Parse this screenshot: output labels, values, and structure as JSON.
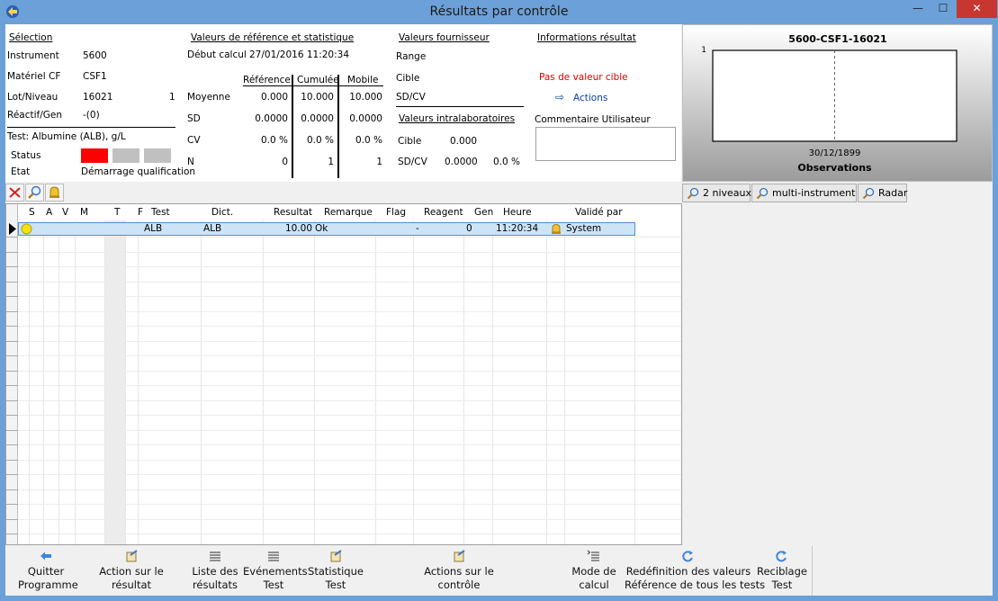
{
  "window": {
    "title": "Résultats par contrôle",
    "minimize": "—",
    "maximize": "☐",
    "close": "✕"
  },
  "selection": {
    "header": "Sélection",
    "instrument_label": "Instrument",
    "instrument_value": "5600",
    "materiel_label": "Matériel CF",
    "materiel_value": "CSF1",
    "lot_label": "Lot/Niveau",
    "lot_value": "16021",
    "niveau_value": "1",
    "reactif_label": "Réactif/Gen",
    "reactif_value": "-(0)",
    "test_label": "Test: Albumine (ALB), g/L",
    "status_label": "Status",
    "etat_label": "Etat",
    "etat_value": "Démarrage qualification",
    "status_colors": [
      "#ff0000",
      "#c0c0c0",
      "#c0c0c0"
    ]
  },
  "reference": {
    "header": "Valeurs de référence et statistique",
    "debut_label": "Début calcul",
    "debut_value": "27/01/2016 11:20:34",
    "columns": [
      "Référence",
      "Cumulée",
      "Mobile"
    ],
    "rows": [
      {
        "label": "Moyenne",
        "values": [
          "0.000",
          "10.000",
          "10.000"
        ]
      },
      {
        "label": "SD",
        "values": [
          "0.0000",
          "0.0000",
          "0.0000"
        ]
      },
      {
        "label": "CV",
        "values": [
          "0.0 %",
          "0.0 %",
          "0.0 %"
        ]
      },
      {
        "label": "N",
        "values": [
          "0",
          "1",
          "1"
        ]
      }
    ]
  },
  "fournisseur": {
    "header": "Valeurs fournisseur",
    "range_label": "Range",
    "cible_label": "Cible",
    "sdcv_label": "SD/CV",
    "intra_header": "Valeurs intralaboratoires",
    "intra_cible_label": "Cible",
    "intra_cible_value": "0.000",
    "intra_sdcv_label": "SD/CV",
    "intra_sd_value": "0.0000",
    "intra_cv_value": "0.0 %"
  },
  "resultat_info": {
    "header": "Informations résultat",
    "message": "Pas de valeur cible",
    "actions_label": "Actions",
    "comment_label": "Commentaire Utilisateur",
    "comment_value": ""
  },
  "chart_data": {
    "type": "line",
    "title": "5600-CSF1-16021",
    "xlabel": "Observations",
    "x_tick_labels": [
      "30/12/1899"
    ],
    "y_tick_labels": [
      "1"
    ],
    "series": [],
    "grid": false,
    "legend": "none"
  },
  "toolbar": {
    "delete_icon": "cross-icon",
    "zoom_icon": "magnifier-icon",
    "alarm_icon": "bell-icon"
  },
  "right_toolbar": {
    "btn_2niveaux": "2 niveaux",
    "btn_multi": "multi-instrument",
    "btn_radar": "Radar"
  },
  "grid": {
    "columns": [
      "S",
      "A",
      "V",
      "M",
      "T",
      "F",
      "Test",
      "Dict.",
      "Resultat",
      "Remarque",
      "Flag",
      "Reagent",
      "Gen",
      "Heure",
      "Validé par"
    ],
    "rows": [
      {
        "test": "ALB",
        "dict": "ALB",
        "resultat": "10.00",
        "remarque": "Ok",
        "flag": "",
        "reagent": "-",
        "gen": "0",
        "heure": "11:20:34",
        "valide": "System"
      }
    ]
  },
  "bottom_buttons": {
    "quitter": [
      "Quitter",
      "Programme"
    ],
    "action_resultat": [
      "Action sur le",
      "résultat"
    ],
    "liste": [
      "Liste des",
      "résultats"
    ],
    "evenements": [
      "Evénements",
      "Test"
    ],
    "statistique": [
      "Statistique",
      "Test"
    ],
    "action_controle": [
      "Actions sur le",
      "contrôle"
    ],
    "mode_calcul": [
      "Mode de",
      "calcul"
    ],
    "redefinition": [
      "Redéfinition des valeurs",
      "Référence de tous les tests"
    ],
    "reciblage": [
      "Reciblage",
      "Test"
    ]
  }
}
